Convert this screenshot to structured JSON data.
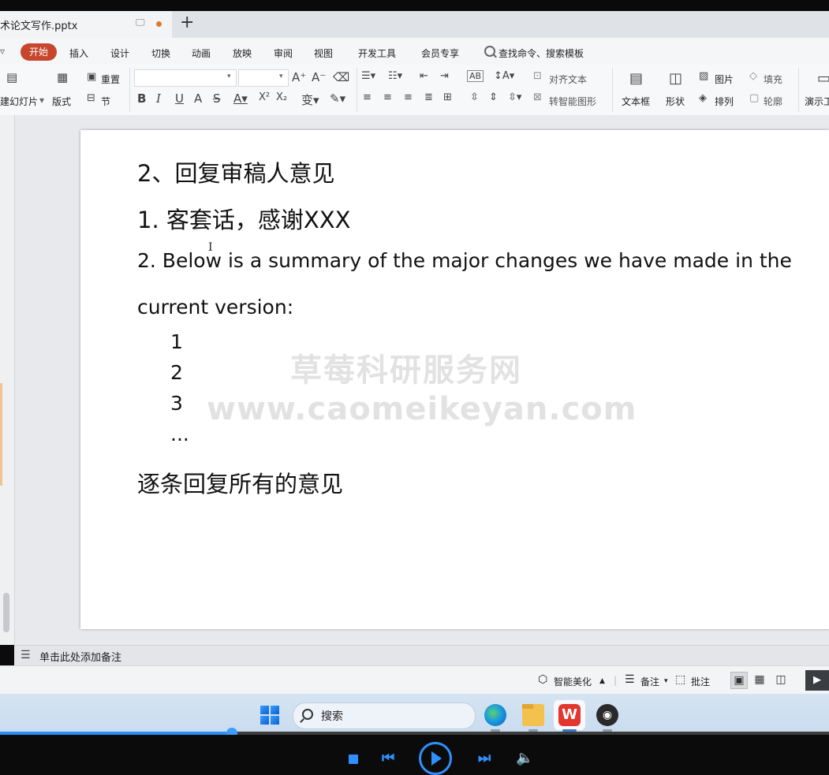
{
  "window": {
    "doc_tab_title": "术论文写作.pptx",
    "new_tab_symbol": "+"
  },
  "menu": {
    "dropdown_symbol": "▿",
    "items": [
      "开始",
      "插入",
      "设计",
      "切换",
      "动画",
      "放映",
      "审阅",
      "视图",
      "开发工具",
      "会员专享"
    ],
    "search_placeholder": "查找命令、搜索模板"
  },
  "ribbon": {
    "new_slide": "建幻灯片",
    "layout": "版式",
    "reset": "重置",
    "section": "节",
    "align_text": "对齐文本",
    "smart_graphic": "转智能图形",
    "text_box": "文本框",
    "shape": "形状",
    "picture": "图片",
    "arrange": "排列",
    "fill": "填充",
    "outline": "轮廓",
    "present": "演示工"
  },
  "slide": {
    "heading": "2、回复审稿人意见",
    "point1": "1. 客套话，感谢XXX",
    "point2_line1": "2. Below is a summary of the major changes we have made in the",
    "point2_line2": "current version:",
    "sub_items": [
      "1",
      "2",
      "3",
      "..."
    ],
    "closing": "逐条回复所有的意见"
  },
  "watermark": {
    "line1": "草莓科研服务网",
    "line2": "www.caomeikeyan.com"
  },
  "notes": {
    "placeholder": "单击此处添加备注"
  },
  "statusbar": {
    "smart_beautify": "智能美化",
    "notes": "备注",
    "comments": "批注"
  },
  "taskbar": {
    "search_label": "搜索"
  },
  "player": {
    "progress_fraction": 0.28
  },
  "colors": {
    "accent_start_tab": "#c7462e",
    "player_blue": "#2f8fff"
  }
}
